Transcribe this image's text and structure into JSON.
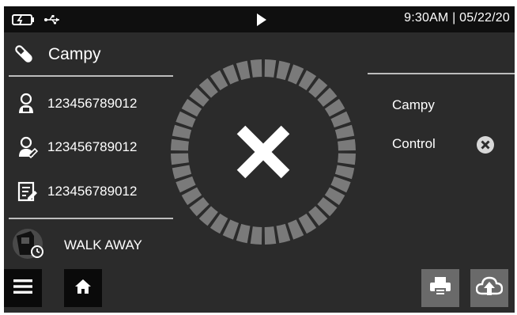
{
  "statusbar": {
    "battery_icon": "battery-charging-icon",
    "usb_icon": "usb-icon",
    "play_icon": "play-icon",
    "clock": "9:30AM | 05/22/20"
  },
  "header": {
    "icon": "tube-pen-icon",
    "title": "Campy"
  },
  "left_panel": {
    "patient_id": {
      "icon": "patient-icon",
      "value": "123456789012"
    },
    "operator_id": {
      "icon": "operator-icon",
      "value": "123456789012"
    },
    "sample_id": {
      "icon": "sample-form-icon",
      "value": "123456789012"
    },
    "walk_away": {
      "icon": "walk-away-device-icon",
      "label": "WALK AWAY"
    }
  },
  "center": {
    "status_icon": "x-fail-icon",
    "ring_segments": 40
  },
  "right_panel": {
    "items": [
      {
        "label": "Campy"
      },
      {
        "label": "Control"
      }
    ],
    "clear_icon": "circle-x-icon"
  },
  "bottom_bar": {
    "menu_icon": "menu-icon",
    "home_icon": "home-icon",
    "print_icon": "printer-icon",
    "upload_icon": "cloud-upload-icon"
  },
  "colors": {
    "background": "#2b2b2b",
    "statusbar": "#0f0f0f",
    "ring_segment": "#7a7a7a",
    "text": "#ffffff"
  }
}
